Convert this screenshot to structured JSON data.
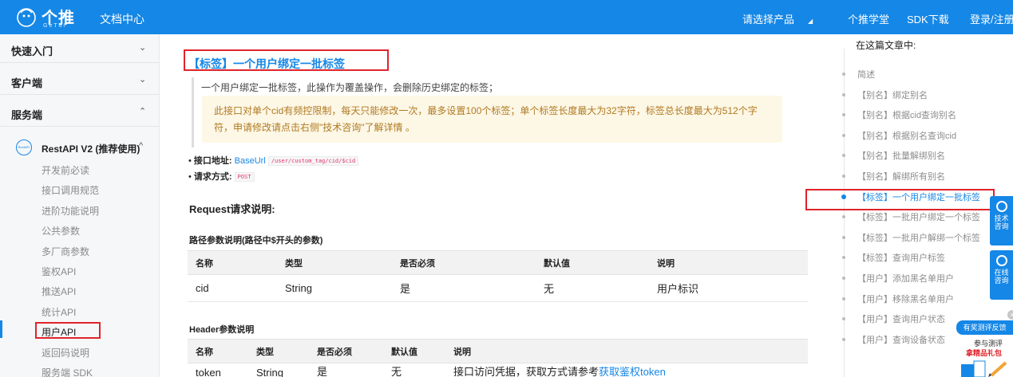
{
  "header": {
    "logo_text": "个推",
    "logo_sub": "GeTuI",
    "doc_center": "文档中心",
    "product_select": "请选择产品",
    "academy": "个推学堂",
    "sdk_download": "SDK下载",
    "login": "登录/注册"
  },
  "sidebar": {
    "sections": [
      {
        "label": "快速入门",
        "caret": "⌄"
      },
      {
        "label": "客户端",
        "caret": "⌄"
      },
      {
        "label": "服务端",
        "caret": "⌃"
      }
    ],
    "api_group": {
      "label": "RestAPI V2 (推荐使用)",
      "caret": "^",
      "badge": "RestAPI"
    },
    "items": [
      {
        "label": "开发前必读"
      },
      {
        "label": "接口调用规范"
      },
      {
        "label": "进阶功能说明"
      },
      {
        "label": "公共参数"
      },
      {
        "label": "多厂商参数"
      },
      {
        "label": "鉴权API"
      },
      {
        "label": "推送API"
      },
      {
        "label": "统计API"
      },
      {
        "label": "用户API"
      },
      {
        "label": "返回码说明"
      },
      {
        "label": "服务端 SDK"
      }
    ]
  },
  "main": {
    "title": "【标签】一个用户绑定一批标签",
    "intro": "一个用户绑定一批标签，此操作为覆盖操作，会删除历史绑定的标签；",
    "warning": "此接口对单个cid有频控限制，每天只能修改一次，最多设置100个标签；单个标签长度最大为32字符，标签总长度最大为512个字符，申请修改请点击右侧\"技术咨询\"了解详情 。",
    "endpoint_label": "接口地址:",
    "endpoint_base": "BaseUrl",
    "endpoint_path": "/user/custom_tag/cid/$cid",
    "method_label": "请求方式:",
    "method": "POST",
    "request_heading": "Request请求说明:",
    "path_params_heading": "路径参数说明(路径中$开头的参数)",
    "path_table": {
      "headers": [
        "名称",
        "类型",
        "是否必须",
        "默认值",
        "说明"
      ],
      "rows": [
        [
          "cid",
          "String",
          "是",
          "无",
          "用户标识"
        ]
      ]
    },
    "header_params_heading": "Header参数说明",
    "header_table": {
      "headers": [
        "名称",
        "类型",
        "是否必须",
        "默认值",
        "说明"
      ],
      "rows": [
        [
          "token",
          "String",
          "是",
          "无",
          "接口访问凭据，获取方式请参考",
          "获取鉴权token"
        ]
      ]
    }
  },
  "toc": {
    "heading": "在这篇文章中:",
    "items": [
      {
        "label": "简述"
      },
      {
        "label": "【别名】绑定别名"
      },
      {
        "label": "【别名】根据cid查询别名"
      },
      {
        "label": "【别名】根据别名查询cid"
      },
      {
        "label": "【别名】批量解绑别名"
      },
      {
        "label": "【别名】解绑所有别名"
      },
      {
        "label": "【标签】一个用户绑定一批标签",
        "active": true
      },
      {
        "label": "【标签】一批用户绑定一个标签"
      },
      {
        "label": "【标签】一批用户解绑一个标签"
      },
      {
        "label": "【标签】查询用户标签"
      },
      {
        "label": "【用户】添加黑名单用户"
      },
      {
        "label": "【用户】移除黑名单用户"
      },
      {
        "label": "【用户】查询用户状态"
      },
      {
        "label": "【用户】查询设备状态"
      }
    ]
  },
  "float": {
    "tech": [
      "技术",
      "咨询"
    ],
    "online": [
      "在线",
      "咨询"
    ],
    "promo_top": "有奖测评反馈",
    "promo_a": "参与测评",
    "promo_b": "拿精品礼包"
  },
  "colors": {
    "brand": "#1587e6",
    "highlight_box": "#e0242b",
    "warning_bg": "#fdf7e6"
  }
}
